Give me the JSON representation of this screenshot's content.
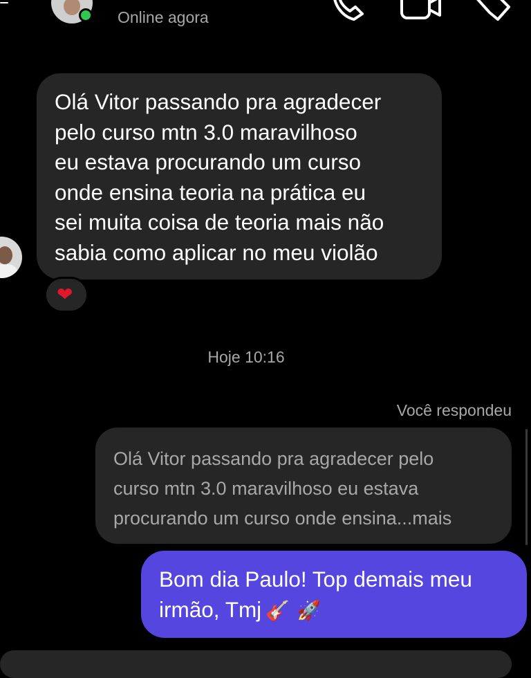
{
  "header": {
    "status": "Online agora",
    "icons": [
      "back-icon",
      "phone-icon",
      "video-icon",
      "tag-icon"
    ]
  },
  "messages": {
    "incoming": {
      "text": "Olá Vitor passando pra agradecer\npelo curso mtn 3.0 maravilhoso\neu estava procurando um curso\nonde ensina teoria na prática eu\nsei muita coisa de teoria mais não\nsabia como aplicar no meu violão",
      "reaction": "❤"
    },
    "timestamp": "Hoje 10:16",
    "reply_label": "Você respondeu",
    "quoted": "Olá Vitor passando pra agradecer pelo\ncurso mtn 3.0 maravilhoso eu estava\nprocurando um curso onde ensina...mais",
    "outgoing": {
      "line1": "Bom dia Paulo! Top demais meu",
      "line2": "irmão, Tmj",
      "emoji_guitar": "🎸",
      "emoji_rocket": "🚀"
    }
  },
  "colors": {
    "background": "#000000",
    "incoming_bubble": "#262626",
    "outgoing_bubble": "#5446de",
    "online_dot": "#2fc94f",
    "muted_text": "#a8a8a8"
  }
}
